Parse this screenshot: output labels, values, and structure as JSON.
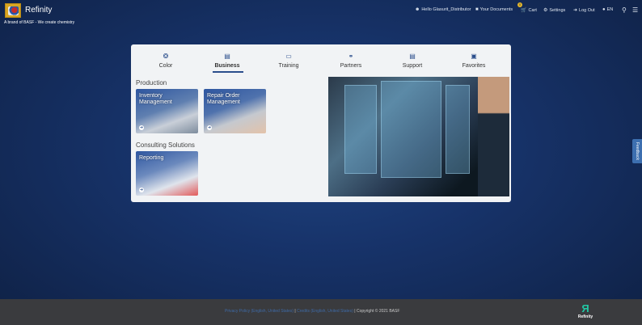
{
  "header": {
    "brand": "Refinity",
    "tagline": "A brand of BASF - We create chemistry",
    "user": "Hello Glasurit_Distributor",
    "documents": "Your Documents",
    "cart": "Cart",
    "cart_count": "0",
    "settings": "Settings",
    "logout": "Log Out",
    "language": "EN"
  },
  "tabs": [
    {
      "label": "Color",
      "icon": "color-circles-icon"
    },
    {
      "label": "Business",
      "icon": "chart-icon"
    },
    {
      "label": "Training",
      "icon": "monitor-icon"
    },
    {
      "label": "Partners",
      "icon": "handshake-icon"
    },
    {
      "label": "Support",
      "icon": "chat-icon"
    },
    {
      "label": "Favorites",
      "icon": "star-icon"
    }
  ],
  "active_tab": "Business",
  "sections": [
    {
      "title": "Production",
      "tiles": [
        "Inventory Management",
        "Repair Order Management"
      ]
    },
    {
      "title": "Consulting Solutions",
      "tiles": [
        "Reporting"
      ]
    }
  ],
  "feedback": "Feedback",
  "footer": {
    "privacy": "Privacy Policy (English, United States)",
    "credits": "Credits (English, United States)",
    "copyright": "Copyright © 2021 BASF",
    "logo": "Refinity"
  }
}
